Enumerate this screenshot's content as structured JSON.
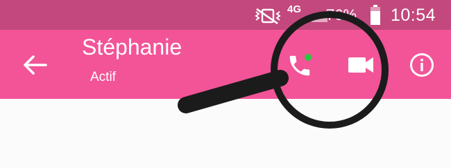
{
  "status_bar": {
    "network": "4G",
    "battery_percent": "76%",
    "time": "10:54",
    "icons": [
      "vibrate-muted-icon",
      "network-4g-icon",
      "signal-icon",
      "battery-icon"
    ]
  },
  "app_bar": {
    "back_icon": "back-arrow-icon",
    "contact_name": "Stéphanie",
    "contact_status": "Actif",
    "actions": [
      "phone-call-icon",
      "video-call-icon",
      "info-icon"
    ],
    "online_indicator_color": "#27c93f"
  },
  "colors": {
    "status_bar": "#c2487d",
    "app_bar": "#f25497",
    "page_background": "#fbfbfb",
    "magnifier": "#1b1b1b"
  }
}
